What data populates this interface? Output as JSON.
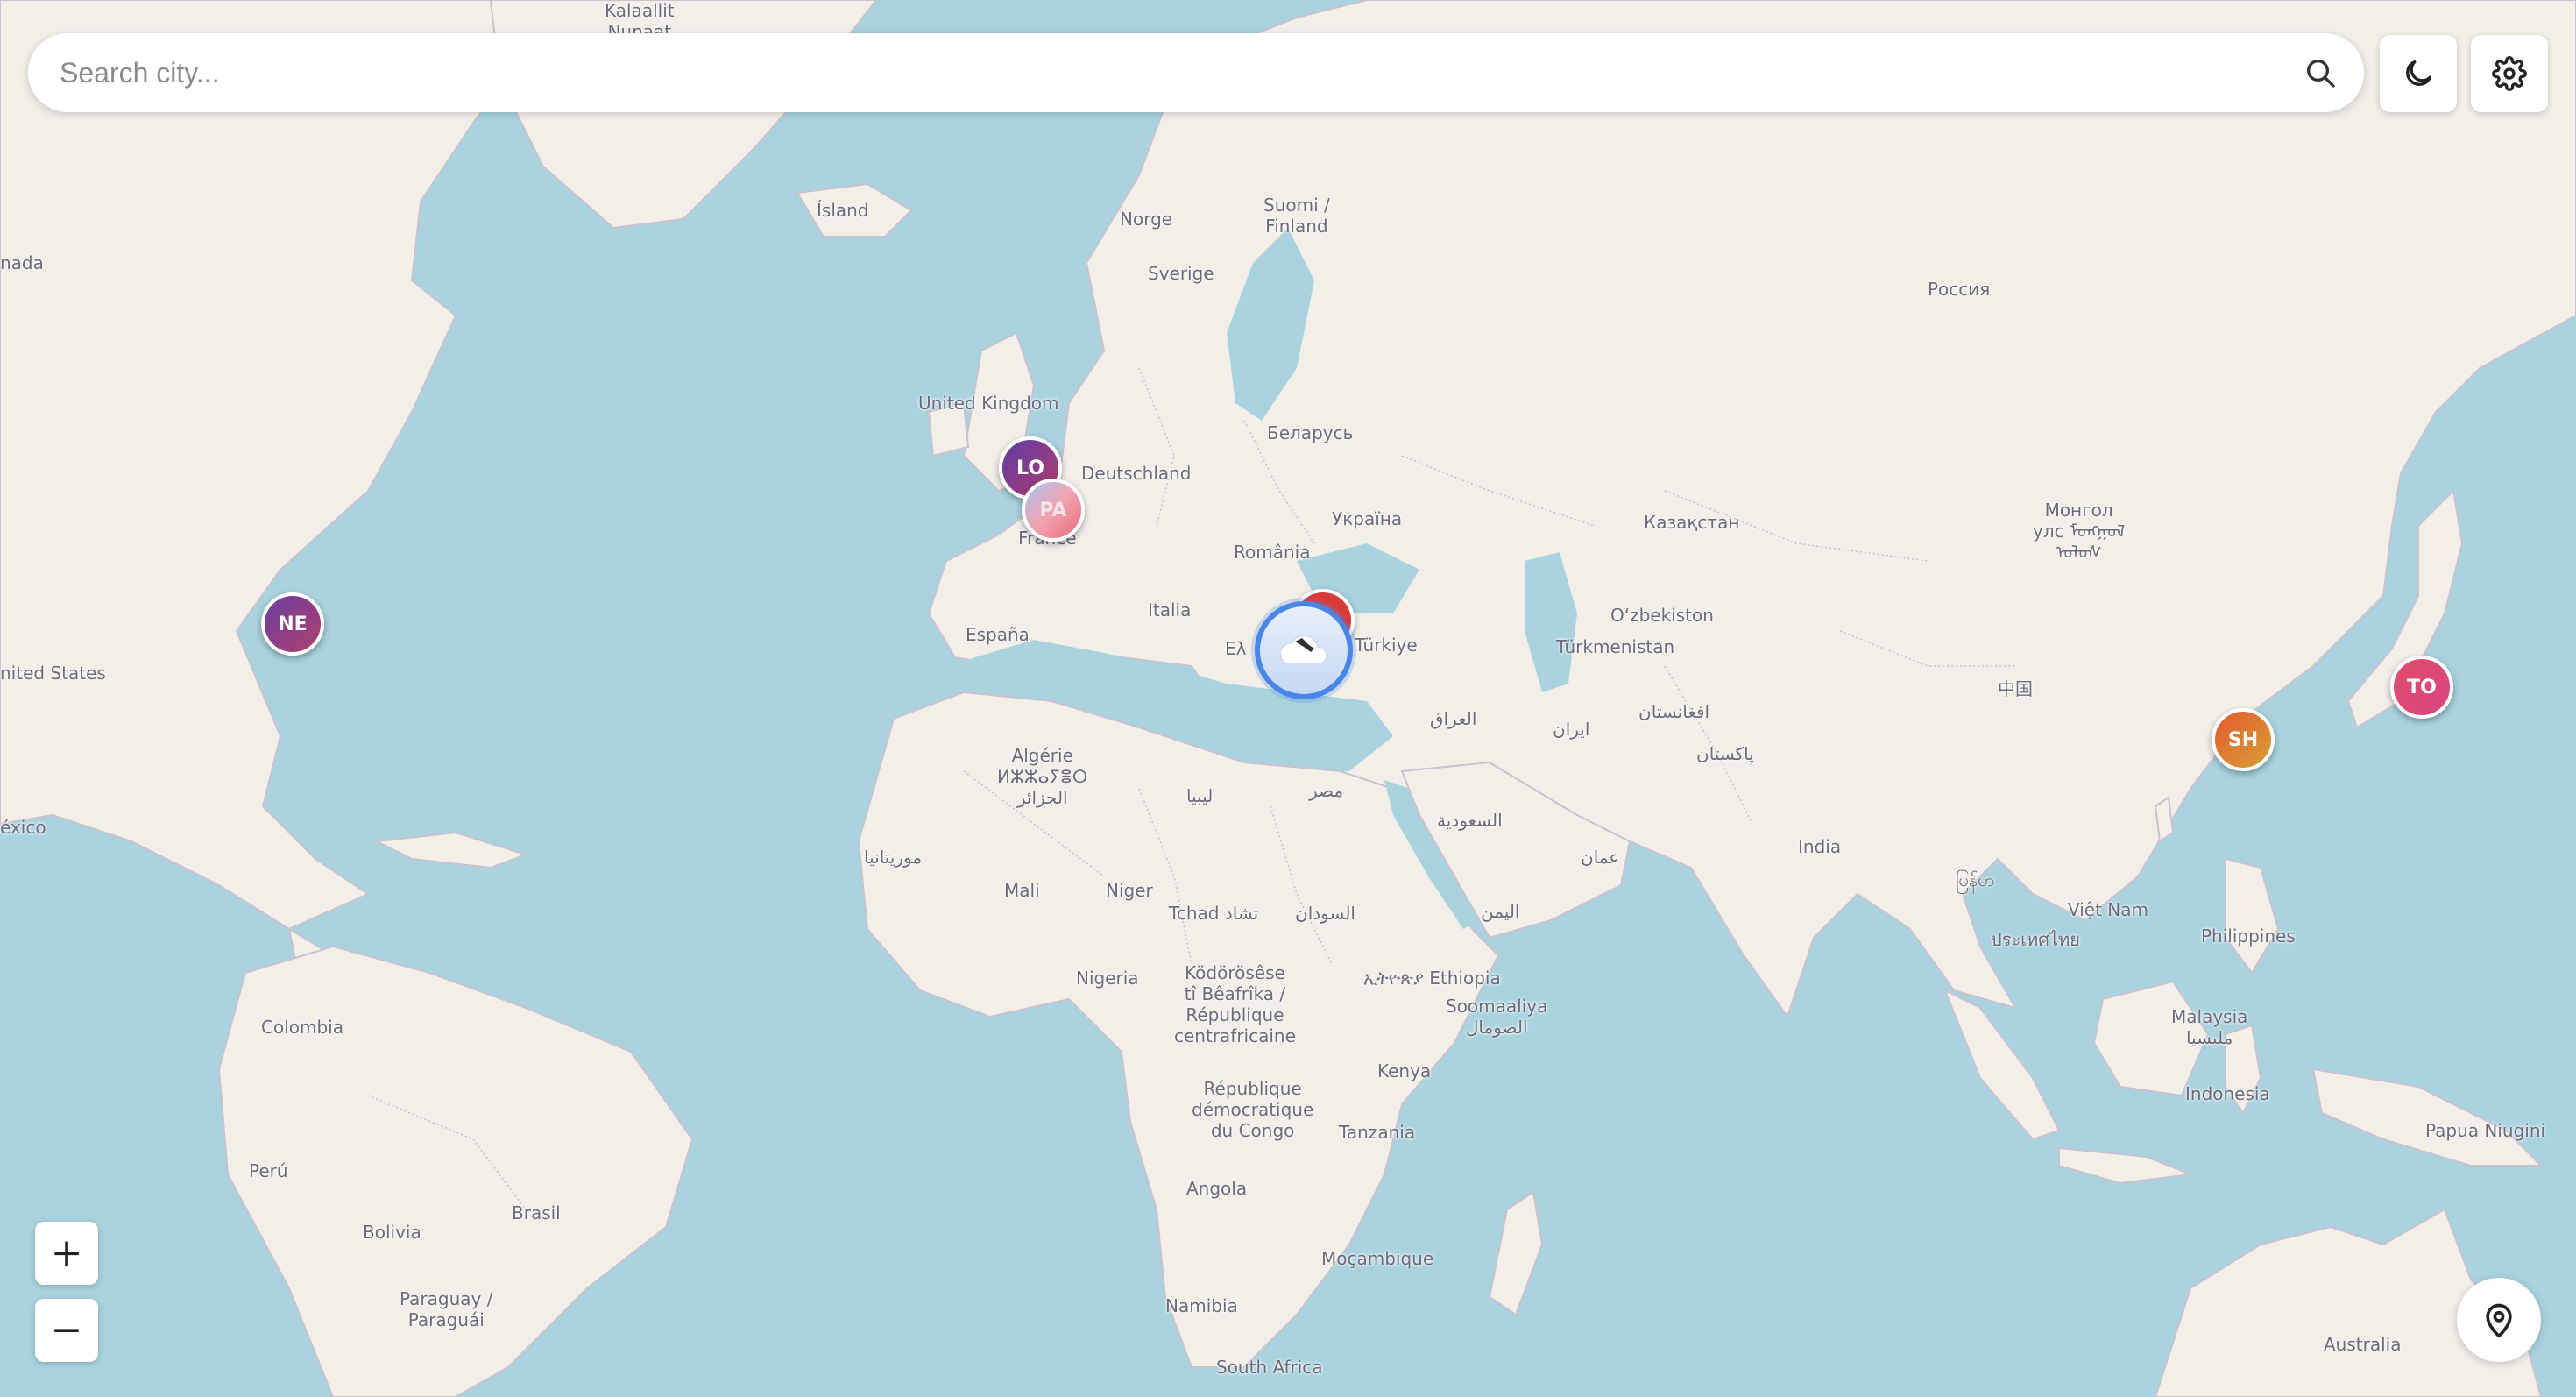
{
  "search": {
    "placeholder": "Search city..."
  },
  "icons": {
    "search": "search-icon",
    "theme": "moon-icon",
    "settings": "gear-icon",
    "zoom_in": "plus-icon",
    "zoom_out": "minus-icon",
    "locate": "map-pin-icon",
    "weather": "cloud-icon"
  },
  "zoom": {
    "in_label": "+",
    "out_label": "−"
  },
  "markers": [
    {
      "id": "ne",
      "label": "NE"
    },
    {
      "id": "lo",
      "label": "LO"
    },
    {
      "id": "pa",
      "label": "PA"
    },
    {
      "id": "sh",
      "label": "SH"
    },
    {
      "id": "to",
      "label": "TO"
    }
  ],
  "labels": {
    "kalaallit": "Kalaallit\nNunaat",
    "canada": "nada",
    "iceland": "Ísland",
    "norway": "Norge",
    "finland": "Suomi /\nFinland",
    "sweden": "Sverige",
    "russia": "Россия",
    "uk": "United Kingdom",
    "belarus": "Беларусь",
    "germany": "Deutschland",
    "ukraine": "Україна",
    "kazakhstan": "Казақстан",
    "mongolia": "Монгол\nулс ᠮᠣᠩᠭᠣᠯ\nᠤᠯᠤᠰ",
    "france": "France",
    "romania": "România",
    "usa": "nited States",
    "spain": "España",
    "italy": "Italia",
    "greece": "Ελ",
    "turkey": "Türkiye",
    "uzbekistan": "O‘zbekiston",
    "turkmenistan": "Türkmenistan",
    "iraq": "العراق",
    "iran": "ایران",
    "afghanistan": "افغانستان",
    "china": "中国",
    "pakistan": "پاکستان",
    "algeria": "Algérie\nⵍⵣⵣⴰⵢⴻⵔ\nالجزائر",
    "libya": "ليبيا",
    "egypt": "مصر",
    "saudi": "السعودية",
    "mexico": "éxico",
    "mauritania": "موريتانيا",
    "oman": "عمان",
    "india": "India",
    "mali": "Mali",
    "niger": "Niger",
    "chad": "Tchad تشاد",
    "sudan": "السودان",
    "yemen": "اليمن",
    "myanmar": "မြန်မာ",
    "vietnam": "Việt Nam",
    "thailand": "ประเทศไทย",
    "philippines": "Philippines",
    "nigeria": "Nigeria",
    "car": "Ködörösêse\ntî Bêafrîka /\nRépublique\ncentrafricaine",
    "ethiopia": "ኢትዮጵያ Ethiopia",
    "somalia": "Soomaaliya\nالصومال",
    "colombia": "Colombia",
    "malaysia": "Malaysia\nمليسيا",
    "kenya": "Kenya",
    "drc": "République\ndémocratique\ndu Congo",
    "indonesia": "Indonesia",
    "tanzania": "Tanzania",
    "papua": "Papua Niugini",
    "peru": "Perú",
    "brasil": "Brasil",
    "angola": "Angola",
    "bolivia": "Bolivia",
    "mozambique": "Moçambique",
    "paraguay": "Paraguay /\nParaguái",
    "namibia": "Namibia",
    "australia": "Australia",
    "south_africa": "South Africa"
  },
  "colors": {
    "water": "#aad3df",
    "land": "#f2efe9",
    "accent": "#4a86e8"
  }
}
